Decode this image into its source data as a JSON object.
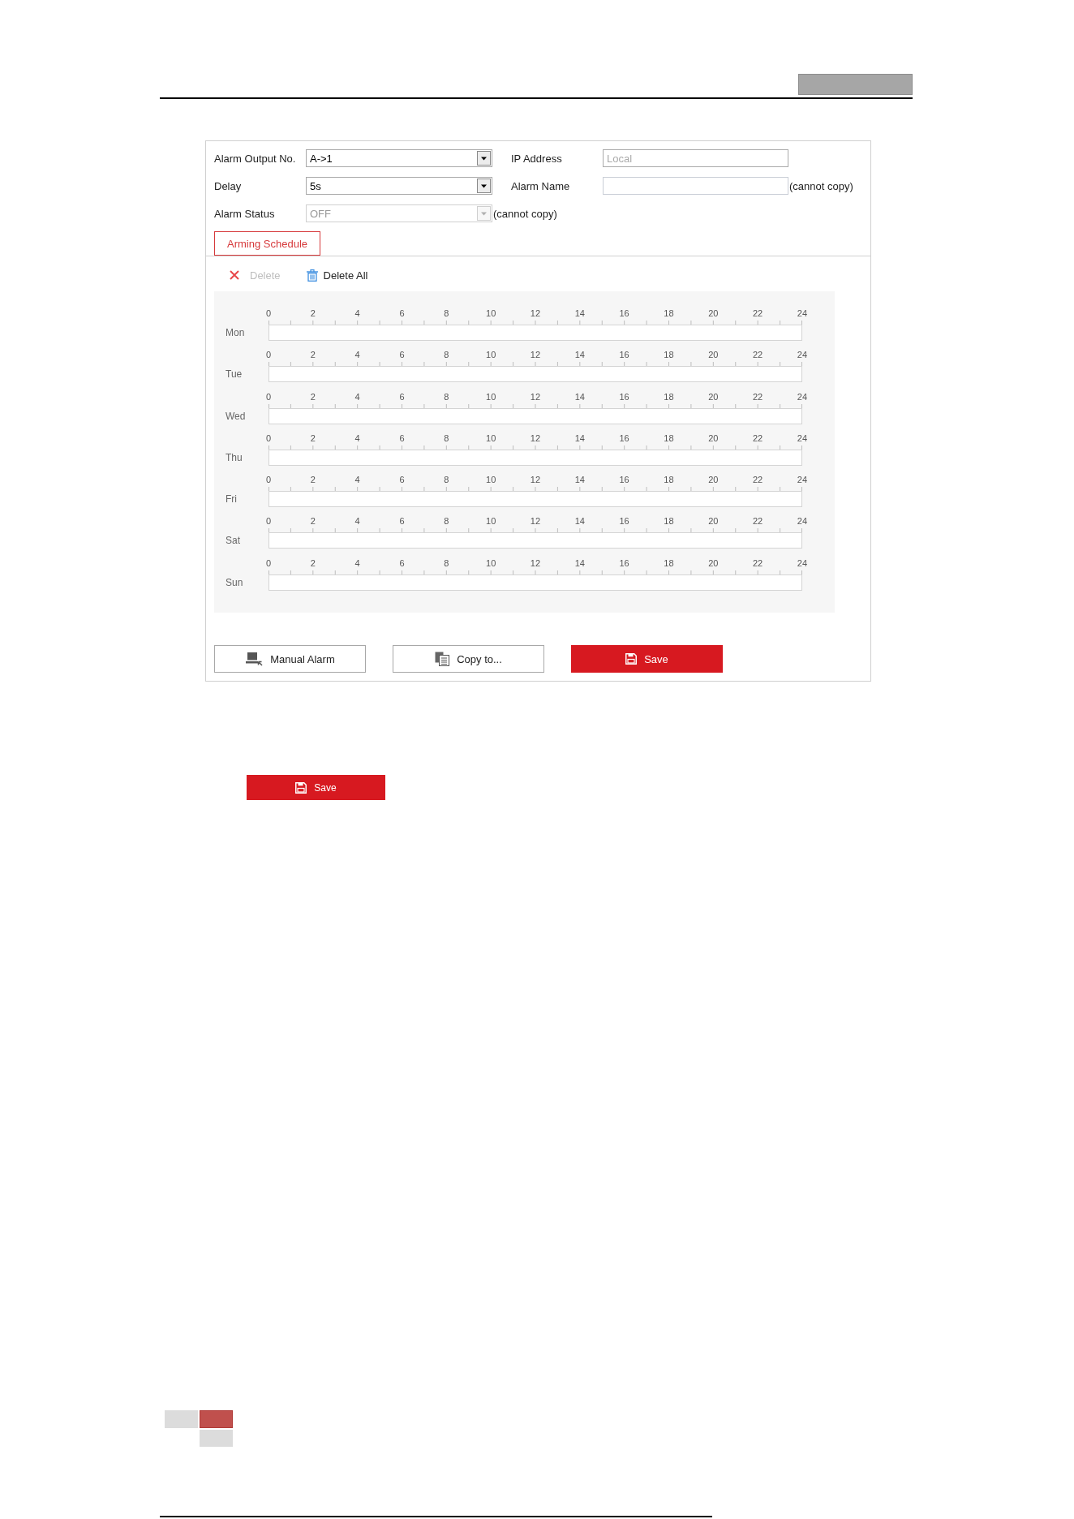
{
  "form": {
    "rows": [
      {
        "fields": [
          {
            "label": "Alarm Output No.",
            "kind": "select",
            "value": "A->1",
            "disabled": false
          },
          {
            "label": "IP Address",
            "kind": "text",
            "value": "Local",
            "disabled": true
          }
        ]
      },
      {
        "fields": [
          {
            "label": "Delay",
            "kind": "select",
            "value": "5s",
            "disabled": false
          },
          {
            "label": "Alarm Name",
            "kind": "text",
            "disabled": false,
            "note": "(cannot copy)"
          }
        ]
      },
      {
        "fields": [
          {
            "label": "Alarm Status",
            "kind": "select",
            "value": "OFF",
            "disabled": true,
            "note": "(cannot copy)"
          }
        ]
      }
    ]
  },
  "tabs": [
    {
      "label": "Arming Schedule",
      "selected": true
    }
  ],
  "toolbar": [
    {
      "label": "Delete",
      "kind": "delete",
      "disabled": true
    },
    {
      "label": "Delete All",
      "kind": "delete-all",
      "disabled": false
    }
  ],
  "schedule": {
    "days": [
      {
        "label": "Mon",
        "hour_labels": [
          "0",
          "2",
          "4",
          "6",
          "8",
          "10",
          "12",
          "14",
          "16",
          "18",
          "20",
          "22",
          "24"
        ]
      },
      {
        "label": "Tue",
        "hour_labels": [
          "0",
          "2",
          "4",
          "6",
          "8",
          "10",
          "12",
          "14",
          "16",
          "18",
          "20",
          "22",
          "24"
        ]
      },
      {
        "label": "Wed",
        "hour_labels": [
          "0",
          "2",
          "4",
          "6",
          "8",
          "10",
          "12",
          "14",
          "16",
          "18",
          "20",
          "22",
          "24"
        ]
      },
      {
        "label": "Thu",
        "hour_labels": [
          "0",
          "2",
          "4",
          "6",
          "8",
          "10",
          "12",
          "14",
          "16",
          "18",
          "20",
          "22",
          "24"
        ]
      },
      {
        "label": "Fri",
        "hour_labels": [
          "0",
          "2",
          "4",
          "6",
          "8",
          "10",
          "12",
          "14",
          "16",
          "18",
          "20",
          "22",
          "24"
        ]
      },
      {
        "label": "Sat",
        "hour_labels": [
          "0",
          "2",
          "4",
          "6",
          "8",
          "10",
          "12",
          "14",
          "16",
          "18",
          "20",
          "22",
          "24"
        ]
      },
      {
        "label": "Sun",
        "hour_labels": [
          "0",
          "2",
          "4",
          "6",
          "8",
          "10",
          "12",
          "14",
          "16",
          "18",
          "20",
          "22",
          "24"
        ]
      }
    ]
  },
  "buttons": [
    {
      "label": "Manual Alarm",
      "kind": "manual-alarm",
      "primary": false
    },
    {
      "label": "Copy to...",
      "kind": "copy",
      "primary": false
    },
    {
      "label": "Save",
      "kind": "save",
      "primary": true
    }
  ],
  "save_button": {
    "label": "Save",
    "kind": "save"
  }
}
